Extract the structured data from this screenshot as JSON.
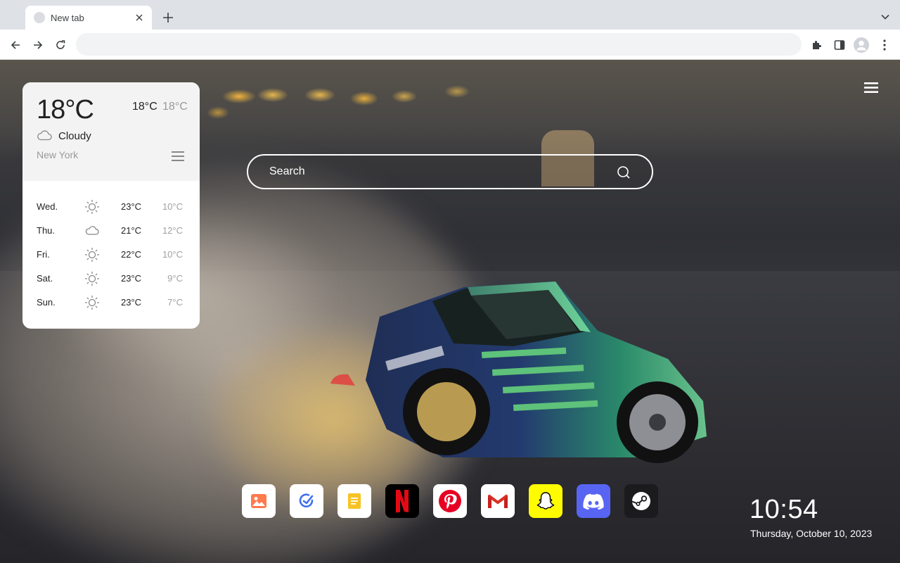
{
  "browser": {
    "tab_title": "New tab",
    "address_value": "",
    "icons": [
      "tab-close-icon",
      "plus-icon",
      "chevron-down-icon",
      "back-arrow-icon",
      "forward-arrow-icon",
      "reload-icon",
      "puzzle-icon",
      "side-panel-icon",
      "profile-icon",
      "kebab-menu-icon"
    ]
  },
  "weather": {
    "current_temp": "18°C",
    "high": "18°C",
    "low": "18°C",
    "condition": "Cloudy",
    "condition_icon": "cloud-icon",
    "city": "New York",
    "forecast": [
      {
        "day": "Wed.",
        "icon": "sun-icon",
        "high": "23°C",
        "low": "10°C"
      },
      {
        "day": "Thu.",
        "icon": "cloud-icon",
        "high": "21°C",
        "low": "12°C"
      },
      {
        "day": "Fri.",
        "icon": "sun-icon",
        "high": "22°C",
        "low": "10°C"
      },
      {
        "day": "Sat.",
        "icon": "sun-icon",
        "high": "23°C",
        "low": "9°C"
      },
      {
        "day": "Sun.",
        "icon": "sun-icon",
        "high": "23°C",
        "low": "7°C"
      }
    ]
  },
  "search": {
    "placeholder": "Search"
  },
  "dock": {
    "apps": [
      {
        "name": "photos",
        "icon": "photos-icon",
        "bg": "#ffffff"
      },
      {
        "name": "tasks",
        "icon": "check-circle-icon",
        "bg": "#ffffff"
      },
      {
        "name": "notes",
        "icon": "note-icon",
        "bg": "#ffffff"
      },
      {
        "name": "netflix",
        "icon": "netflix-icon",
        "bg": "#000000"
      },
      {
        "name": "pinterest",
        "icon": "pinterest-icon",
        "bg": "#ffffff"
      },
      {
        "name": "gmail",
        "icon": "gmail-icon",
        "bg": "#ffffff"
      },
      {
        "name": "snapchat",
        "icon": "snapchat-icon",
        "bg": "#fffc00"
      },
      {
        "name": "discord",
        "icon": "discord-icon",
        "bg": "#5865f2"
      },
      {
        "name": "steam",
        "icon": "steam-icon",
        "bg": "#1b1b1d"
      }
    ]
  },
  "clock": {
    "time": "10:54",
    "date": "Thursday, October 10, 2023"
  }
}
